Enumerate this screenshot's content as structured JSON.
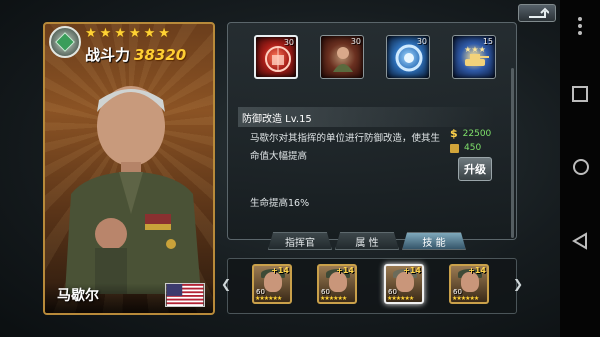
{
  "hero": {
    "power_label": "战斗力",
    "power_value": "38320",
    "name": "马歇尔",
    "star_count": 6,
    "faction_icon": "cube-emblem-icon",
    "flag_icon": "usa-flag-icon"
  },
  "skills": {
    "items": [
      {
        "icon": "turret-defense-icon",
        "level": "30"
      },
      {
        "icon": "soldier-rage-icon",
        "level": "30"
      },
      {
        "icon": "shield-ring-icon",
        "level": "30"
      },
      {
        "icon": "tank-stars-icon",
        "level": "15"
      }
    ],
    "selected": {
      "name": "防御改造  Lv.15",
      "description": "马歇尔对其指挥的单位进行防御改造，使其生命值大幅提高",
      "cost_money": "22500",
      "cost_ammo": "450",
      "upgrade_label": "升级",
      "effect": "生命提高16%"
    }
  },
  "tabs": [
    {
      "label": "指挥官",
      "active": false
    },
    {
      "label": "属  性",
      "active": false
    },
    {
      "label": "技  能",
      "active": true
    }
  ],
  "hero_list": [
    {
      "plus": "+14",
      "level": "60",
      "stars": "★★★★★★"
    },
    {
      "plus": "+14",
      "level": "60",
      "stars": "★★★★★★"
    },
    {
      "plus": "+14",
      "level": "60",
      "stars": "★★★★★★"
    },
    {
      "plus": "+14",
      "level": "60",
      "stars": "★★★★★★"
    }
  ],
  "colors": {
    "gold": "#ffcf33",
    "money": "#7fe06a",
    "frame": "#b88a3a"
  }
}
